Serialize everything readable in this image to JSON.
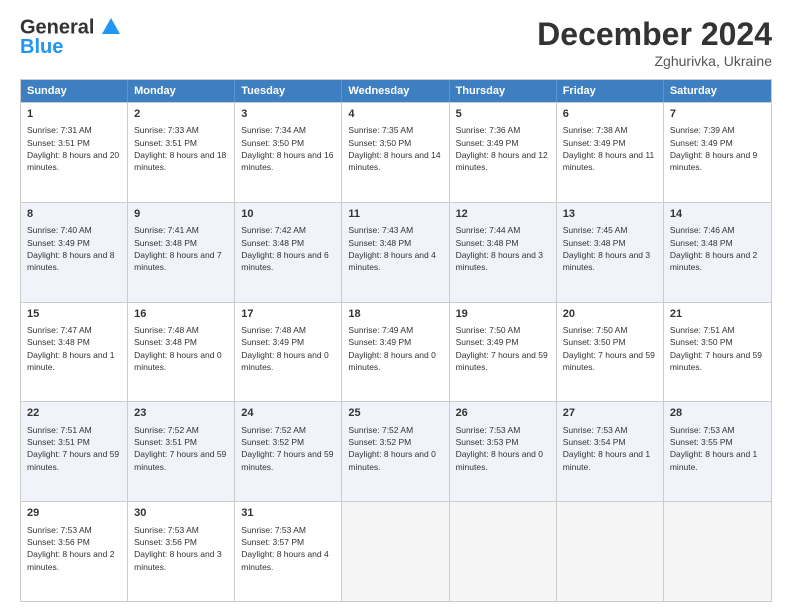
{
  "header": {
    "logo_line1": "General",
    "logo_line2": "Blue",
    "month_title": "December 2024",
    "location": "Zghurivka, Ukraine"
  },
  "days_of_week": [
    "Sunday",
    "Monday",
    "Tuesday",
    "Wednesday",
    "Thursday",
    "Friday",
    "Saturday"
  ],
  "rows": [
    [
      {
        "day": "1",
        "sunrise": "Sunrise: 7:31 AM",
        "sunset": "Sunset: 3:51 PM",
        "daylight": "Daylight: 8 hours and 20 minutes."
      },
      {
        "day": "2",
        "sunrise": "Sunrise: 7:33 AM",
        "sunset": "Sunset: 3:51 PM",
        "daylight": "Daylight: 8 hours and 18 minutes."
      },
      {
        "day": "3",
        "sunrise": "Sunrise: 7:34 AM",
        "sunset": "Sunset: 3:50 PM",
        "daylight": "Daylight: 8 hours and 16 minutes."
      },
      {
        "day": "4",
        "sunrise": "Sunrise: 7:35 AM",
        "sunset": "Sunset: 3:50 PM",
        "daylight": "Daylight: 8 hours and 14 minutes."
      },
      {
        "day": "5",
        "sunrise": "Sunrise: 7:36 AM",
        "sunset": "Sunset: 3:49 PM",
        "daylight": "Daylight: 8 hours and 12 minutes."
      },
      {
        "day": "6",
        "sunrise": "Sunrise: 7:38 AM",
        "sunset": "Sunset: 3:49 PM",
        "daylight": "Daylight: 8 hours and 11 minutes."
      },
      {
        "day": "7",
        "sunrise": "Sunrise: 7:39 AM",
        "sunset": "Sunset: 3:49 PM",
        "daylight": "Daylight: 8 hours and 9 minutes."
      }
    ],
    [
      {
        "day": "8",
        "sunrise": "Sunrise: 7:40 AM",
        "sunset": "Sunset: 3:49 PM",
        "daylight": "Daylight: 8 hours and 8 minutes."
      },
      {
        "day": "9",
        "sunrise": "Sunrise: 7:41 AM",
        "sunset": "Sunset: 3:48 PM",
        "daylight": "Daylight: 8 hours and 7 minutes."
      },
      {
        "day": "10",
        "sunrise": "Sunrise: 7:42 AM",
        "sunset": "Sunset: 3:48 PM",
        "daylight": "Daylight: 8 hours and 6 minutes."
      },
      {
        "day": "11",
        "sunrise": "Sunrise: 7:43 AM",
        "sunset": "Sunset: 3:48 PM",
        "daylight": "Daylight: 8 hours and 4 minutes."
      },
      {
        "day": "12",
        "sunrise": "Sunrise: 7:44 AM",
        "sunset": "Sunset: 3:48 PM",
        "daylight": "Daylight: 8 hours and 3 minutes."
      },
      {
        "day": "13",
        "sunrise": "Sunrise: 7:45 AM",
        "sunset": "Sunset: 3:48 PM",
        "daylight": "Daylight: 8 hours and 3 minutes."
      },
      {
        "day": "14",
        "sunrise": "Sunrise: 7:46 AM",
        "sunset": "Sunset: 3:48 PM",
        "daylight": "Daylight: 8 hours and 2 minutes."
      }
    ],
    [
      {
        "day": "15",
        "sunrise": "Sunrise: 7:47 AM",
        "sunset": "Sunset: 3:48 PM",
        "daylight": "Daylight: 8 hours and 1 minute."
      },
      {
        "day": "16",
        "sunrise": "Sunrise: 7:48 AM",
        "sunset": "Sunset: 3:48 PM",
        "daylight": "Daylight: 8 hours and 0 minutes."
      },
      {
        "day": "17",
        "sunrise": "Sunrise: 7:48 AM",
        "sunset": "Sunset: 3:49 PM",
        "daylight": "Daylight: 8 hours and 0 minutes."
      },
      {
        "day": "18",
        "sunrise": "Sunrise: 7:49 AM",
        "sunset": "Sunset: 3:49 PM",
        "daylight": "Daylight: 8 hours and 0 minutes."
      },
      {
        "day": "19",
        "sunrise": "Sunrise: 7:50 AM",
        "sunset": "Sunset: 3:49 PM",
        "daylight": "Daylight: 7 hours and 59 minutes."
      },
      {
        "day": "20",
        "sunrise": "Sunrise: 7:50 AM",
        "sunset": "Sunset: 3:50 PM",
        "daylight": "Daylight: 7 hours and 59 minutes."
      },
      {
        "day": "21",
        "sunrise": "Sunrise: 7:51 AM",
        "sunset": "Sunset: 3:50 PM",
        "daylight": "Daylight: 7 hours and 59 minutes."
      }
    ],
    [
      {
        "day": "22",
        "sunrise": "Sunrise: 7:51 AM",
        "sunset": "Sunset: 3:51 PM",
        "daylight": "Daylight: 7 hours and 59 minutes."
      },
      {
        "day": "23",
        "sunrise": "Sunrise: 7:52 AM",
        "sunset": "Sunset: 3:51 PM",
        "daylight": "Daylight: 7 hours and 59 minutes."
      },
      {
        "day": "24",
        "sunrise": "Sunrise: 7:52 AM",
        "sunset": "Sunset: 3:52 PM",
        "daylight": "Daylight: 7 hours and 59 minutes."
      },
      {
        "day": "25",
        "sunrise": "Sunrise: 7:52 AM",
        "sunset": "Sunset: 3:52 PM",
        "daylight": "Daylight: 8 hours and 0 minutes."
      },
      {
        "day": "26",
        "sunrise": "Sunrise: 7:53 AM",
        "sunset": "Sunset: 3:53 PM",
        "daylight": "Daylight: 8 hours and 0 minutes."
      },
      {
        "day": "27",
        "sunrise": "Sunrise: 7:53 AM",
        "sunset": "Sunset: 3:54 PM",
        "daylight": "Daylight: 8 hours and 1 minute."
      },
      {
        "day": "28",
        "sunrise": "Sunrise: 7:53 AM",
        "sunset": "Sunset: 3:55 PM",
        "daylight": "Daylight: 8 hours and 1 minute."
      }
    ],
    [
      {
        "day": "29",
        "sunrise": "Sunrise: 7:53 AM",
        "sunset": "Sunset: 3:56 PM",
        "daylight": "Daylight: 8 hours and 2 minutes."
      },
      {
        "day": "30",
        "sunrise": "Sunrise: 7:53 AM",
        "sunset": "Sunset: 3:56 PM",
        "daylight": "Daylight: 8 hours and 3 minutes."
      },
      {
        "day": "31",
        "sunrise": "Sunrise: 7:53 AM",
        "sunset": "Sunset: 3:57 PM",
        "daylight": "Daylight: 8 hours and 4 minutes."
      },
      null,
      null,
      null,
      null
    ]
  ]
}
